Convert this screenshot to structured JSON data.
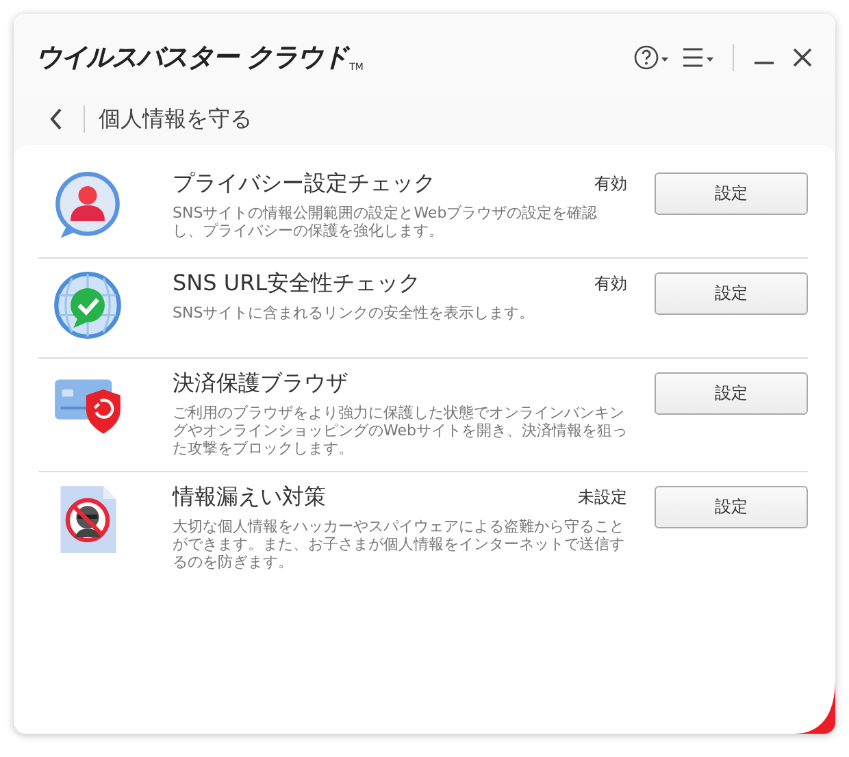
{
  "window": {
    "title": "ウイルスバスター クラウド",
    "trademark": "TM"
  },
  "header": {
    "title": "個人情報を守る"
  },
  "features": [
    {
      "kind": "privacy",
      "title": "プライバシー設定チェック",
      "status": "有効",
      "description": "SNSサイトの情報公開範囲の設定とWebブラウザの設定を確認し、プライバシーの保護を強化します。",
      "button": "設定"
    },
    {
      "kind": "url",
      "title": "SNS URL安全性チェック",
      "status": "有効",
      "description": "SNSサイトに含まれるリンクの安全性を表示します。",
      "button": "設定"
    },
    {
      "kind": "payment",
      "title": "決済保護ブラウザ",
      "description": "ご利用のブラウザをより強力に保護した状態でオンラインバンキングやオンラインショッピングのWebサイトを開き、決済情報を狙った攻撃をブロックします。",
      "button": "設定"
    },
    {
      "kind": "leak",
      "title": "情報漏えい対策",
      "status": "未設定",
      "description": "大切な個人情報をハッカーやスパイウェアによる盗難から守ることができます。また、お子さまが個人情報をインターネットで送信するのを防ぎます。",
      "button": "設定"
    }
  ]
}
